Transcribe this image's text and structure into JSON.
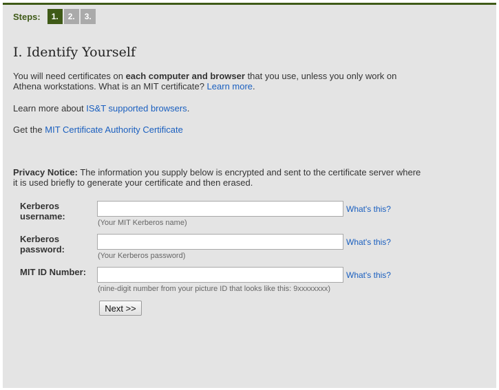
{
  "steps": {
    "label": "Steps:",
    "items": [
      {
        "label": "1.",
        "active": true
      },
      {
        "label": "2.",
        "active": false
      },
      {
        "label": "3.",
        "active": false
      }
    ]
  },
  "title": "I. Identify Yourself",
  "intro": {
    "text1": "You will need certificates on ",
    "bold": "each computer and browser",
    "text2": " that you use, unless you only work on Athena workstations. What is an MIT certificate? ",
    "link": "Learn more",
    "text3": "."
  },
  "browsers": {
    "text1": "Learn more about ",
    "link": "IS&T supported browsers",
    "text2": "."
  },
  "ca_cert": {
    "text1": "Get the ",
    "link": "MIT Certificate Authority Certificate"
  },
  "privacy": {
    "bold": "Privacy Notice:",
    "text": " The information you supply below is encrypted and sent to the certificate server where it is used briefly to generate your certificate and then erased."
  },
  "form": {
    "username": {
      "label_line1": "Kerberos",
      "label_line2": "username:",
      "value": "",
      "help": "What's this?",
      "hint": "(Your MIT Kerberos name)"
    },
    "password": {
      "label_line1": "Kerberos",
      "label_line2": "password:",
      "value": "",
      "help": "What's this?",
      "hint": "(Your Kerberos password)"
    },
    "mitid": {
      "label": "MIT ID Number:",
      "value": "",
      "help": "What's this?",
      "hint": "(nine-digit number from your picture ID that looks like this: 9xxxxxxxx)"
    },
    "next_label": "Next >>"
  },
  "colors": {
    "accent": "#3f5a17",
    "step_inactive": "#aaaaaa",
    "link": "#1a5fbf",
    "background": "#e4e4e4"
  }
}
